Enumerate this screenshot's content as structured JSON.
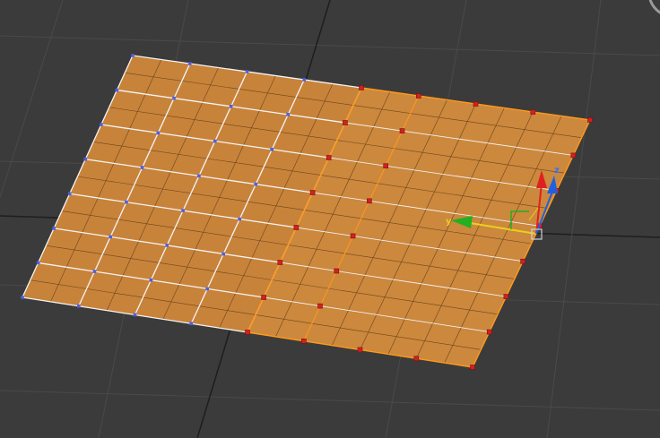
{
  "viewport": {
    "view": "perspective",
    "background_color": "#3b3b3b",
    "grid_color": "#4a4a4a",
    "grid_major_color": "#1a1a1a"
  },
  "plane": {
    "segments_u": 8,
    "segments_v": 7,
    "fill_color": "#c8833a",
    "wire_color": "#6a4520",
    "selected_fill_color": "#e0a050",
    "selection_edge_color": "#ff9a1a",
    "selected_vertex_color": "#d42020",
    "unselected_vertex_color": "#4a60e8",
    "edge_highlight_color": "#f5f5f5"
  },
  "gizmo": {
    "axis_y_label": "y",
    "axis_z_label": "z",
    "x_axis_color": "#e02020",
    "y_axis_color": "#e8d020",
    "y_arrow_color": "#20b020",
    "z_axis_color": "#2060e0"
  }
}
